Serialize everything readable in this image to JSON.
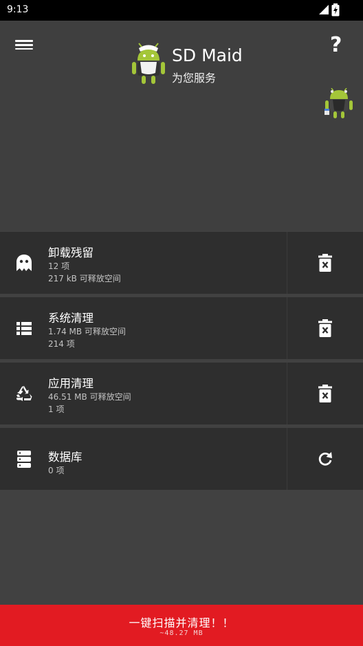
{
  "status_bar": {
    "time": "9:13"
  },
  "header": {
    "app_name": "SD Maid",
    "subtitle": "为您服务"
  },
  "tools": [
    {
      "title": "卸载残留",
      "line1": "12 项",
      "line2": "217 kB 可释放空间",
      "icon": "ghost-icon",
      "action_icon": "delete-icon"
    },
    {
      "title": "系统清理",
      "line1": "1.74 MB 可释放空间",
      "line2": "214 项",
      "icon": "list-icon",
      "action_icon": "delete-icon"
    },
    {
      "title": "应用清理",
      "line1": "46.51 MB 可释放空间",
      "line2": "1 项",
      "icon": "recycle-icon",
      "action_icon": "delete-icon"
    },
    {
      "title": "数据库",
      "line1": "0 项",
      "icon": "database-icon",
      "action_icon": "refresh-icon"
    }
  ],
  "scan_button": {
    "label": "一键扫描并清理！！",
    "size": "~48.27 MB"
  },
  "colors": {
    "accent_red": "#e21b22",
    "android_green": "#a4c639",
    "card_bg": "#2e2e2e",
    "page_bg": "#414141"
  }
}
